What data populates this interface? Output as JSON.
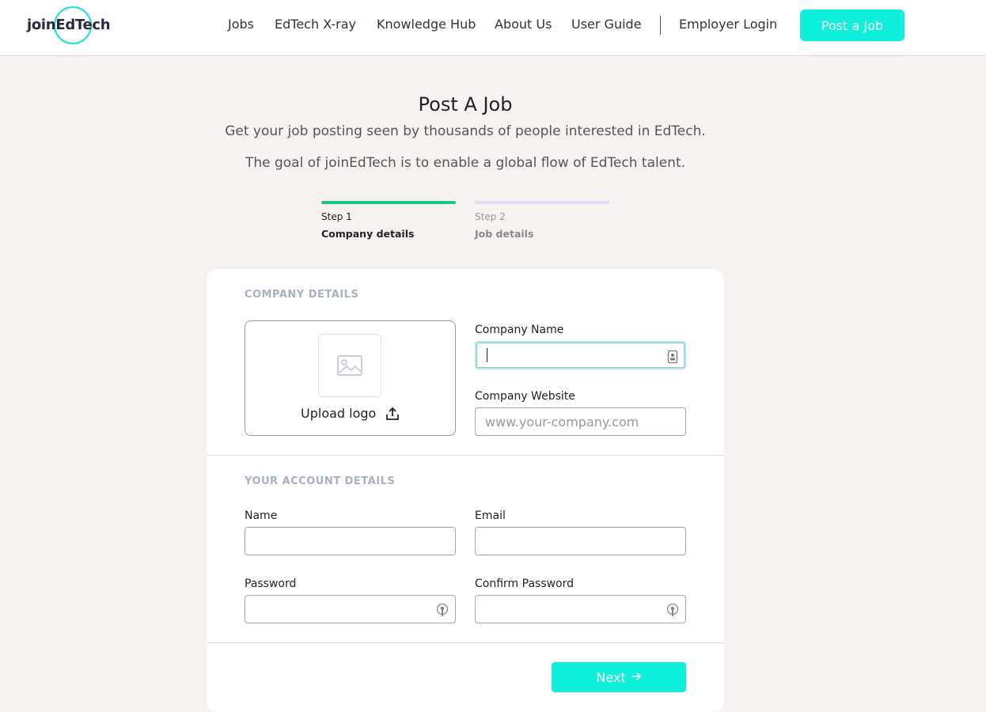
{
  "header": {
    "logo_text": "joinEdTech",
    "nav": [
      {
        "label": "Jobs"
      },
      {
        "label": "EdTech X-ray"
      },
      {
        "label": "Knowledge Hub"
      },
      {
        "label": "About Us"
      },
      {
        "label": "User Guide"
      }
    ],
    "employer_login": "Employer Login",
    "post_job": "Post a Job"
  },
  "hero": {
    "title": "Post A Job",
    "subtitle1": "Get your job posting seen by thousands of people interested in EdTech.",
    "subtitle2": "The goal of joinEdTech is to enable a global flow of EdTech talent."
  },
  "steps": [
    {
      "number": "Step 1",
      "name": "Company details",
      "active": true
    },
    {
      "number": "Step 2",
      "name": "Job details",
      "active": false
    }
  ],
  "form": {
    "company_section": "COMPANY DETAILS",
    "upload_label": "Upload logo",
    "company_name_label": "Company Name",
    "company_name_value": "",
    "company_website_label": "Company Website",
    "company_website_placeholder": "www.your-company.com",
    "account_section": "YOUR ACCOUNT DETAILS",
    "name_label": "Name",
    "email_label": "Email",
    "password_label": "Password",
    "confirm_password_label": "Confirm Password",
    "next_label": "Next"
  },
  "colors": {
    "accent": "#0ef0dc",
    "step_active": "#1ac98a",
    "step_inactive": "#dce0ef",
    "background": "#f6f2f1"
  },
  "icons": [
    "image-placeholder-icon",
    "upload-icon",
    "contact-card-icon",
    "password-key-icon",
    "arrow-right-icon"
  ]
}
